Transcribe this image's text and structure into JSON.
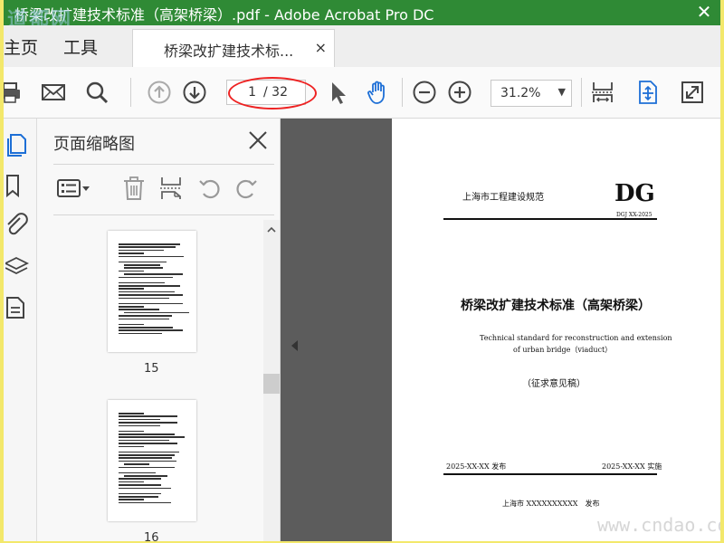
{
  "window": {
    "title": "桥梁改扩建技术标准（高架桥梁）.pdf - Adobe Acrobat Pro DC"
  },
  "watermarks": {
    "top": "道都网",
    "bottom": "www.cndao.com"
  },
  "tabs": {
    "home": "主页",
    "tools": "工具",
    "document": "桥梁改扩建技术标...",
    "close": "×"
  },
  "toolbar": {
    "icons": [
      "print-icon",
      "mail-icon",
      "search-icon",
      "prev-page-icon",
      "next-page-icon",
      "select-cursor-icon",
      "hand-icon",
      "zoom-out-icon",
      "zoom-in-icon",
      "scroll-mode-icon",
      "fit-page-icon",
      "fullscreen-icon"
    ],
    "page_current": "1",
    "page_total": "/ 32",
    "zoom": "31.2%"
  },
  "left_rail": {
    "icons": [
      "page-thumbnails-icon",
      "bookmarks-icon",
      "attachments-icon",
      "layers-icon",
      "document-properties-icon"
    ]
  },
  "thumbnail_panel": {
    "title": "页面缩略图",
    "tools": [
      "options-icon",
      "delete-icon",
      "insert-page-icon",
      "rotate-left-icon",
      "rotate-right-icon"
    ],
    "pages": [
      {
        "label": "15"
      },
      {
        "label": "16"
      }
    ]
  },
  "document_page": {
    "header_left": "上海市工程建设规范",
    "header_right": "DG",
    "header_code": "DGJ XX-2025",
    "title": "桥梁改扩建技术标准（高架桥梁）",
    "english_line1": "Technical standard for reconstruction and extension",
    "english_line2": "of urban bridge（viaduct）",
    "draft_note": "（征求意见稿）",
    "publish_date": "2025-XX-XX 发布",
    "implement_date": "2025-XX-XX 实施",
    "publisher": "上海市 XXXXXXXXXX　发布"
  },
  "colors": {
    "titlebar": "#2f8a35",
    "accent_blue": "#1d6fd6",
    "annotation_red": "#e22222",
    "frame": "#f3e86b"
  }
}
